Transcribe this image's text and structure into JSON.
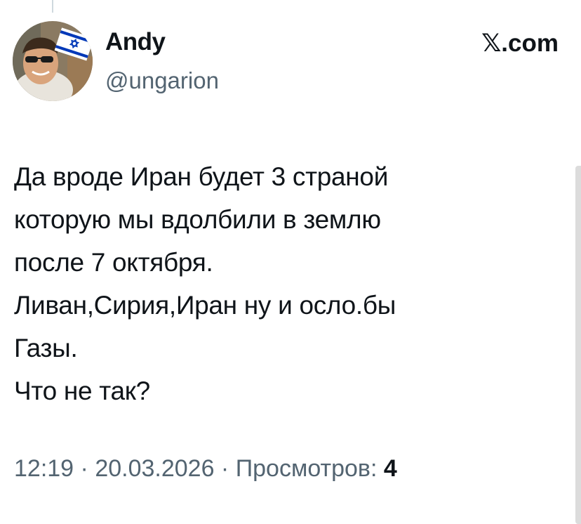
{
  "author": {
    "display_name": "Andy",
    "handle": "@ungarion"
  },
  "brand": "𝕏.com",
  "tweet": {
    "lines": [
      "Да вроде Иран будет 3 страной",
      "которую мы вдолбили в землю",
      "после 7 октября.",
      "Ливан,Сирия,Иран ну и осло.бы",
      "Газы.",
      "Что не так?"
    ]
  },
  "meta": {
    "time": "12:19",
    "separator": " · ",
    "date": "20.03.2026",
    "views_label": "Просмотров: ",
    "views_count": "4"
  },
  "colors": {
    "text_primary": "#0f1419",
    "text_secondary": "#536471",
    "thread_line": "#cfd9de",
    "flag_blue": "#0038b8"
  },
  "icons": {
    "avatar": "user-photo-with-israel-flag"
  }
}
